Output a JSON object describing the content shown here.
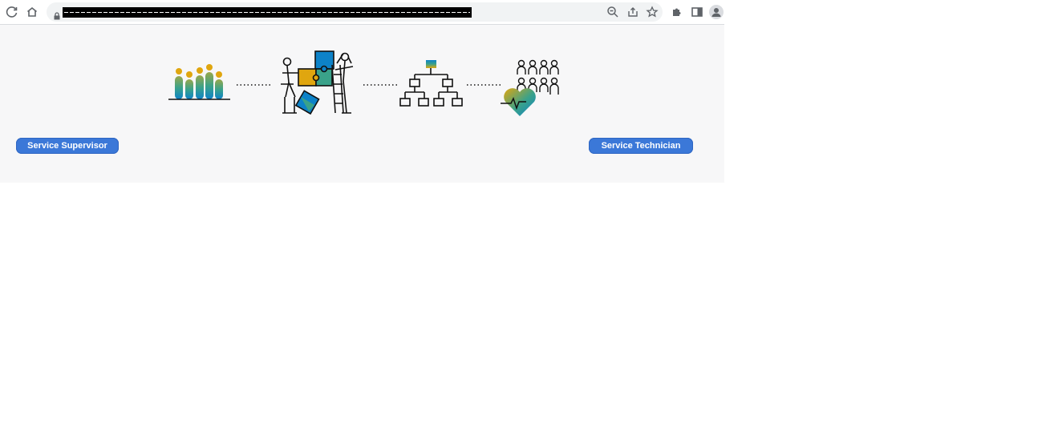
{
  "browser": {
    "icons": [
      "reload-icon",
      "home-icon",
      "lock-icon",
      "zoom-icon",
      "share-icon",
      "bookmark-star-icon",
      "extensions-icon",
      "side-panel-icon",
      "profile-avatar-icon"
    ]
  },
  "process": {
    "steps": [
      "people-bars-illustration",
      "puzzle-team-illustration",
      "org-chart-illustration",
      "workforce-health-illustration"
    ],
    "colors": {
      "gold": "#e0a60f",
      "teal": "#3aa28a",
      "blue": "#0d82c8",
      "ink": "#111111"
    }
  },
  "roles": {
    "supervisor_label": "Service Supervisor",
    "technician_label": "Service Technician",
    "button_color": "#3b78d8"
  }
}
